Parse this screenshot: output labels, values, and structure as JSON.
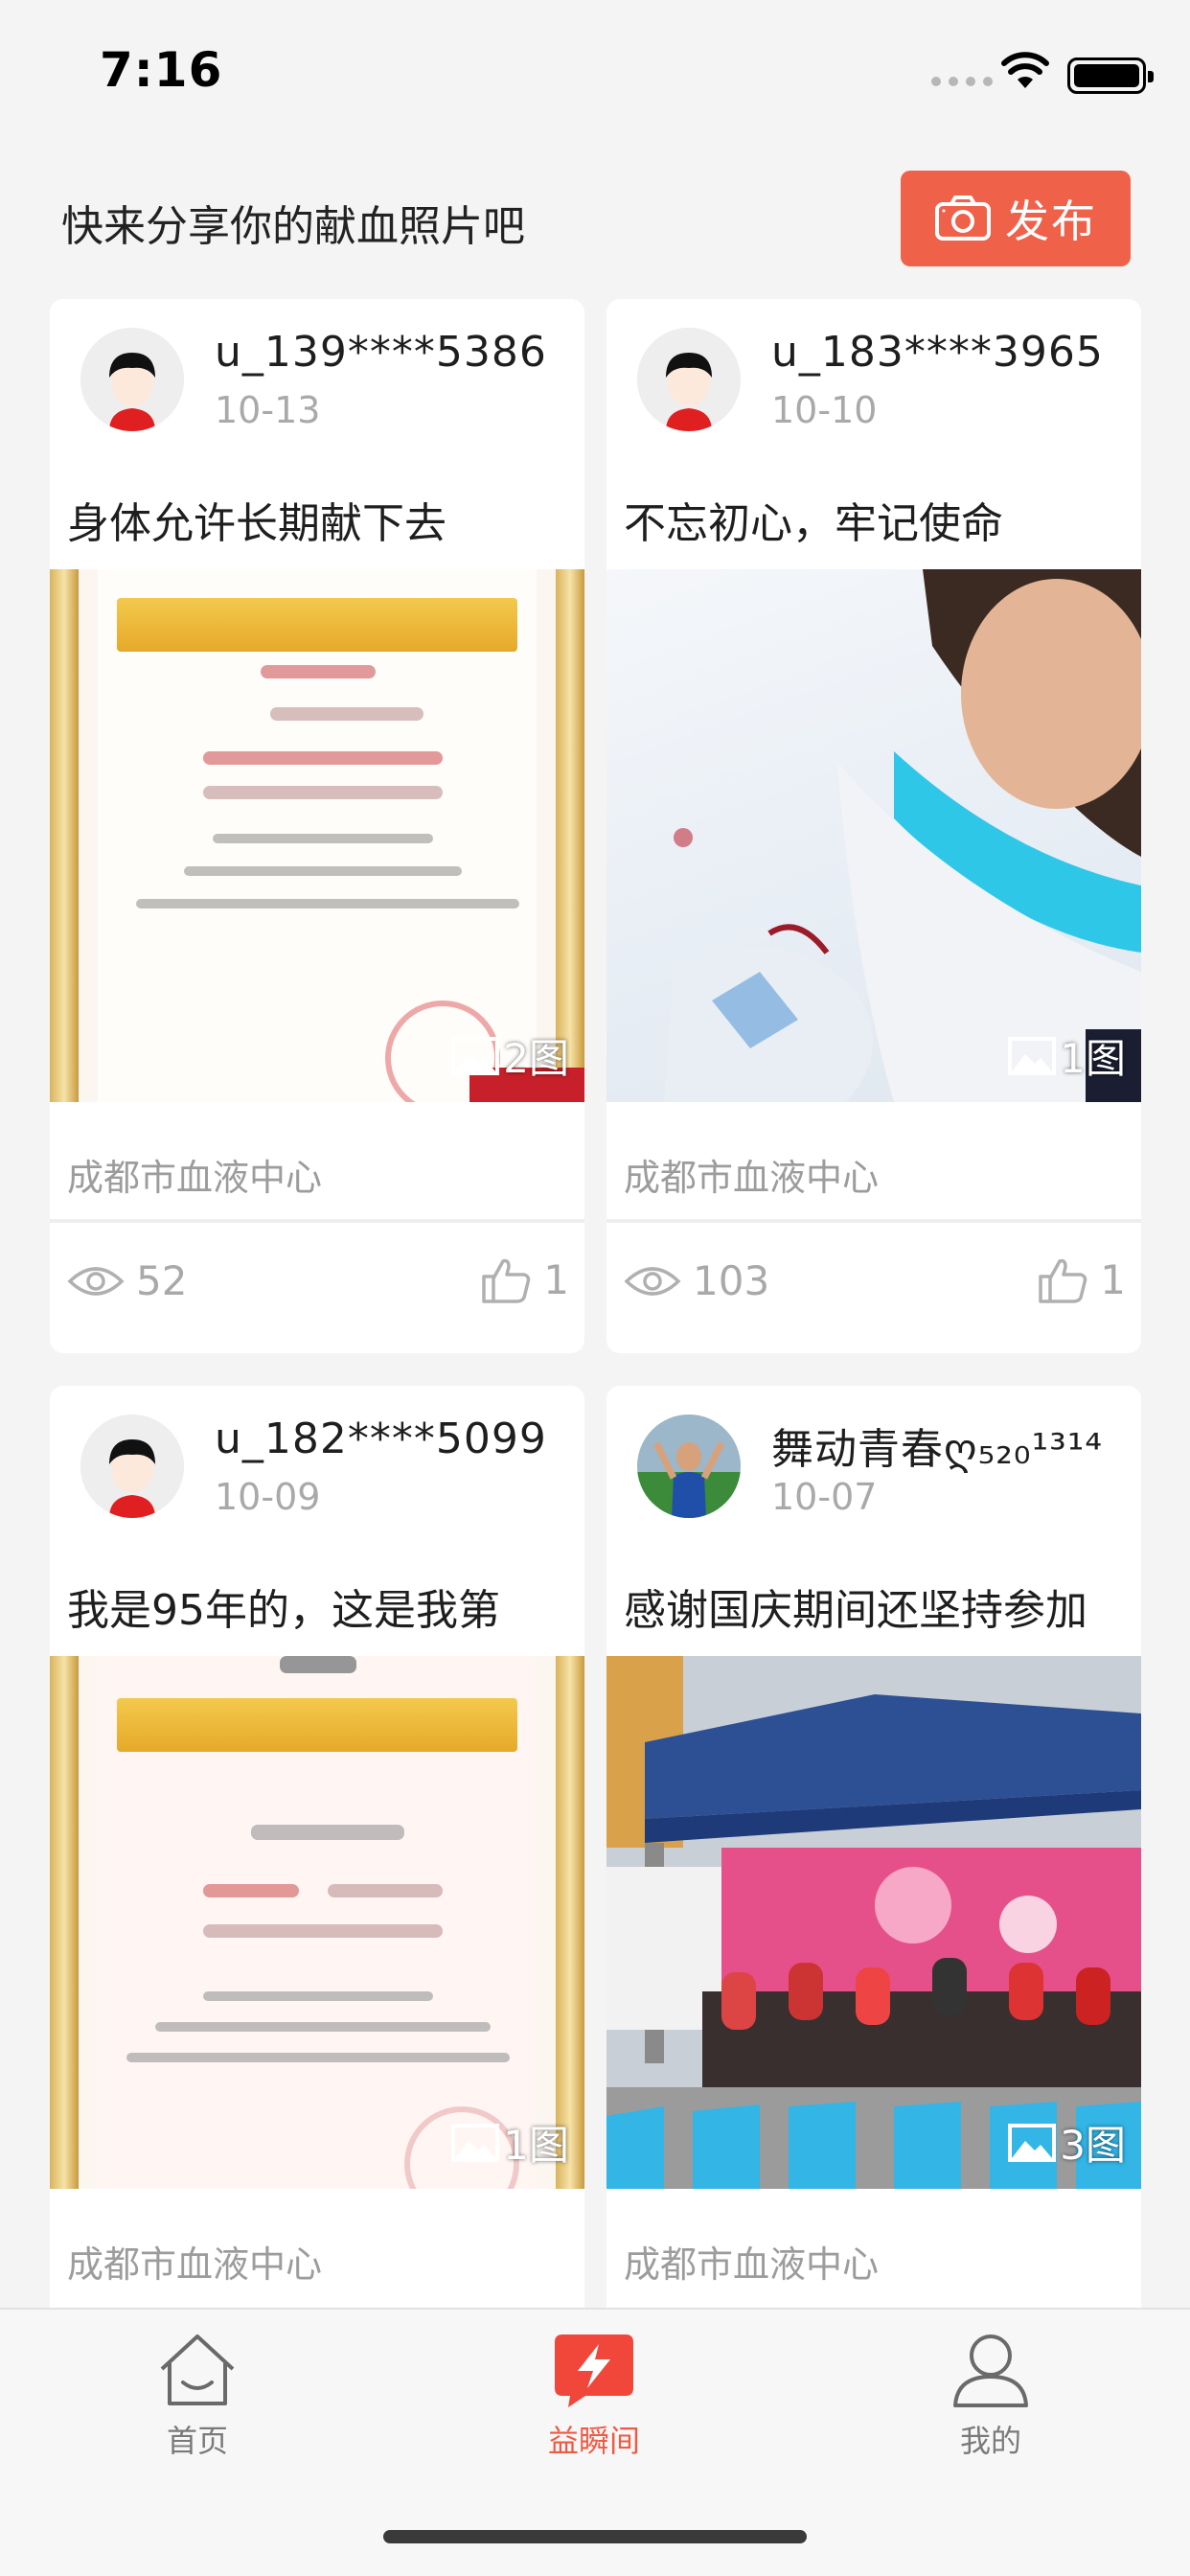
{
  "status_bar": {
    "time": "7:16"
  },
  "header": {
    "title": "快来分享你的献血照片吧",
    "publish_label": "发布"
  },
  "accent": "#f0614a",
  "posts": [
    {
      "username": "u_139****5386",
      "date": "10-13",
      "text": "身体允许长期献下去",
      "photo_count": "2图",
      "org": "成都市血液中心",
      "views": "52",
      "likes": "1",
      "photo": "certificate"
    },
    {
      "username": "u_183****3965",
      "date": "10-10",
      "text": "不忘初心，牢记使命",
      "photo_count": "1图",
      "org": "成都市血液中心",
      "views": "103",
      "likes": "1",
      "photo": "selfie"
    },
    {
      "username": "u_182****5099",
      "date": "10-09",
      "text": "我是95年的，这是我第",
      "photo_count": "1图",
      "org": "成都市血液中心",
      "photo": "certificate"
    },
    {
      "username": "舞动青春ღ₅₂₀¹³¹⁴",
      "date": "10-07",
      "text": "感谢国庆期间还坚持参加",
      "photo_count": "3图",
      "org": "成都市血液中心",
      "photo": "donation-event"
    }
  ],
  "tabbar": {
    "items": [
      {
        "label": "首页",
        "icon": "home-icon"
      },
      {
        "label": "益瞬间",
        "icon": "lightning-icon",
        "active": true
      },
      {
        "label": "我的",
        "icon": "profile-icon"
      }
    ]
  }
}
